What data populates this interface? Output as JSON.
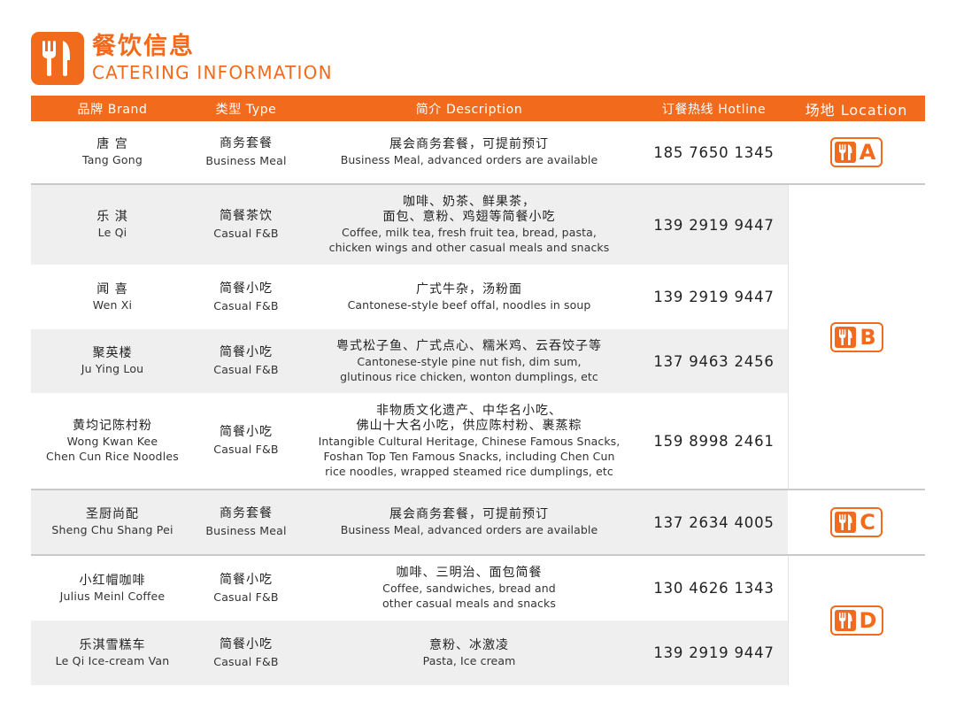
{
  "header": {
    "title_zh": "餐饮信息",
    "title_en": "CATERING INFORMATION",
    "icon": "fork-knife-icon",
    "accent_color": "#f26b1d"
  },
  "columns": {
    "brand": "品牌 Brand",
    "type": "类型 Type",
    "description": "简介 Description",
    "hotline": "订餐热线 Hotline",
    "location": "场地 Location"
  },
  "rows": [
    {
      "brand_zh": "唐 宫",
      "brand_en": [
        "Tang Gong"
      ],
      "type_zh": "商务套餐",
      "type_en": "Business Meal",
      "desc_zh": [
        "展会商务套餐，可提前预订"
      ],
      "desc_en": [
        "Business Meal, advanced orders are available"
      ],
      "hotline": "185 7650 1345"
    },
    {
      "brand_zh": "乐 淇",
      "brand_en": [
        "Le Qi"
      ],
      "type_zh": "简餐茶饮",
      "type_en": "Casual F&B",
      "desc_zh": [
        "咖啡、奶茶、鲜果茶，",
        "面包、意粉、鸡翅等简餐小吃"
      ],
      "desc_en": [
        "Coffee, milk tea, fresh fruit tea, bread, pasta,",
        "chicken wings and other casual meals and snacks"
      ],
      "hotline": "139 2919 9447"
    },
    {
      "brand_zh": "闻 喜",
      "brand_en": [
        "Wen Xi"
      ],
      "type_zh": "简餐小吃",
      "type_en": "Casual F&B",
      "desc_zh": [
        "广式牛杂，汤粉面"
      ],
      "desc_en": [
        "Cantonese-style beef offal, noodles in soup"
      ],
      "hotline": "139 2919 9447"
    },
    {
      "brand_zh": "聚英楼",
      "brand_en": [
        "Ju Ying Lou"
      ],
      "type_zh": "简餐小吃",
      "type_en": "Casual F&B",
      "desc_zh": [
        "粤式松子鱼、广式点心、糯米鸡、云吞饺子等"
      ],
      "desc_en": [
        "Cantonese-style pine nut fish, dim sum,",
        "glutinous rice chicken, wonton dumplings, etc"
      ],
      "hotline": "137 9463 2456"
    },
    {
      "brand_zh": "黄均记陈村粉",
      "brand_en": [
        "Wong Kwan Kee",
        "Chen Cun Rice Noodles"
      ],
      "type_zh": "简餐小吃",
      "type_en": "Casual F&B",
      "desc_zh": [
        "非物质文化遗产、中华名小吃、",
        "佛山十大名小吃，供应陈村粉、裹蒸粽"
      ],
      "desc_en": [
        "Intangible Cultural Heritage, Chinese Famous Snacks,",
        "Foshan Top Ten Famous Snacks, including Chen Cun",
        "rice noodles, wrapped steamed rice dumplings, etc"
      ],
      "hotline": "159 8998 2461"
    },
    {
      "brand_zh": "圣厨尚配",
      "brand_en": [
        "Sheng Chu Shang Pei"
      ],
      "type_zh": "商务套餐",
      "type_en": "Business Meal",
      "desc_zh": [
        "展会商务套餐，可提前预订"
      ],
      "desc_en": [
        "Business Meal, advanced orders are available"
      ],
      "hotline": "137 2634 4005"
    },
    {
      "brand_zh": "小红帽咖啡",
      "brand_en": [
        "Julius Meinl Coffee"
      ],
      "type_zh": "简餐小吃",
      "type_en": "Casual F&B",
      "desc_zh": [
        "咖啡、三明治、面包简餐"
      ],
      "desc_en": [
        "Coffee, sandwiches, bread and",
        "other casual meals and snacks"
      ],
      "hotline": "130 4626 1343"
    },
    {
      "brand_zh": "乐淇雪糕车",
      "brand_en": [
        "Le Qi Ice-cream Van"
      ],
      "type_zh": "简餐小吃",
      "type_en": "Casual F&B",
      "desc_zh": [
        "意粉、冰激凌"
      ],
      "desc_en": [
        "Pasta, Ice cream"
      ],
      "hotline": "139 2919 9447"
    }
  ],
  "locations": [
    {
      "letter": "A",
      "icon": "fork-knife-icon"
    },
    {
      "letter": "B",
      "icon": "fork-knife-icon"
    },
    {
      "letter": "C",
      "icon": "fork-knife-icon"
    },
    {
      "letter": "D",
      "icon": "fork-knife-icon"
    }
  ]
}
